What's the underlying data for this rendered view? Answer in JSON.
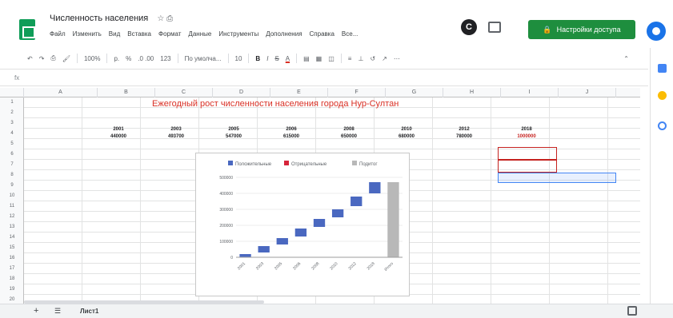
{
  "app": {
    "title": "Численность населения",
    "title_icons": "☆ ⎙",
    "menu": [
      "Файл",
      "Изменить",
      "Вид",
      "Вставка",
      "Формат",
      "Данные",
      "Инструменты",
      "Дополнения",
      "Справка",
      "Все..."
    ],
    "share_label": "Настройки доступа",
    "activity_letter": "C"
  },
  "toolbar": {
    "zoom": "100%",
    "currency": "р.",
    "percent": "%",
    "decimals": ".0 .00",
    "number_format": "123",
    "font": "По умолча...",
    "font_size": "10",
    "bold": "B",
    "italic": "I",
    "strike": "S",
    "text_color": "A"
  },
  "sheet": {
    "columns": [
      "A",
      "B",
      "C",
      "D",
      "E",
      "F",
      "G",
      "H",
      "I",
      "J"
    ],
    "rows": [
      "1",
      "2",
      "3",
      "4",
      "5",
      "6",
      "7",
      "8",
      "9",
      "10",
      "11",
      "12",
      "13",
      "14",
      "15",
      "16",
      "17",
      "18",
      "19",
      "20"
    ],
    "title": "Ежегодный рост численности населения города Нур-Султан",
    "years": [
      "2001",
      "2003",
      "2005",
      "2006",
      "2008",
      "2010",
      "2012",
      "2018"
    ],
    "values": [
      "440000",
      "493700",
      "547000",
      "615000",
      "650000",
      "680000",
      "780000",
      "1000000"
    ]
  },
  "chart_data": {
    "type": "bar",
    "subtype": "waterfall",
    "legend": [
      "Положительные",
      "Отрицательные",
      "Подитог"
    ],
    "legend_position": "top",
    "colors": {
      "positive": "#4a68c0",
      "negative": "#d6253a",
      "subtotal": "#b8b8b8"
    },
    "ylim": [
      0,
      500000
    ],
    "yticks": [
      "500000",
      "400000",
      "300000",
      "200000",
      "100000",
      "0"
    ],
    "categories": [
      "2001",
      "2003",
      "2005",
      "2006",
      "2008",
      "2010",
      "2012",
      "2018",
      "Итого"
    ],
    "segments": [
      {
        "from": 0,
        "to": 20000
      },
      {
        "from": 30000,
        "to": 70000
      },
      {
        "from": 80000,
        "to": 120000
      },
      {
        "from": 130000,
        "to": 180000
      },
      {
        "from": 190000,
        "to": 240000
      },
      {
        "from": 250000,
        "to": 300000
      },
      {
        "from": 320000,
        "to": 380000
      },
      {
        "from": 400000,
        "to": 470000
      },
      {
        "from": 0,
        "to": 470000
      }
    ]
  },
  "bottom": {
    "add_sheet": "+",
    "all_sheets": "☰",
    "tab_label": "Лист1"
  }
}
